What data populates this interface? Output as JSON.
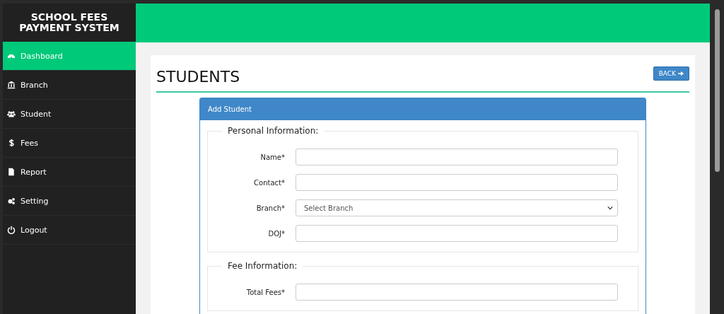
{
  "brand": {
    "title": "SCHOOL FEES PAYMENT SYSTEM"
  },
  "sidebar": {
    "items": [
      {
        "label": "Dashboard",
        "kind": "dashboard",
        "selected": true
      },
      {
        "label": "Branch",
        "kind": "bank",
        "selected": false
      },
      {
        "label": "Student",
        "kind": "users",
        "selected": false
      },
      {
        "label": "Fees",
        "kind": "dollar",
        "selected": false
      },
      {
        "label": "Report",
        "kind": "file",
        "selected": false
      },
      {
        "label": "Setting",
        "kind": "gears",
        "selected": false
      },
      {
        "label": "Logout",
        "kind": "power",
        "selected": false
      }
    ]
  },
  "page": {
    "title": "STUDENTS",
    "back_button": "BACK"
  },
  "panel": {
    "title": "Add Student",
    "sections": [
      {
        "legend": "Personal Information:",
        "fields": [
          {
            "label": "Name*",
            "kind": "input"
          },
          {
            "label": "Contact*",
            "kind": "input"
          },
          {
            "label": "Branch*",
            "kind": "select",
            "placeholder": "Select Branch"
          },
          {
            "label": "DOJ*",
            "kind": "input"
          }
        ]
      },
      {
        "legend": "Fee Information:",
        "fields": [
          {
            "label": "Total Fees*",
            "kind": "input"
          }
        ]
      }
    ]
  }
}
